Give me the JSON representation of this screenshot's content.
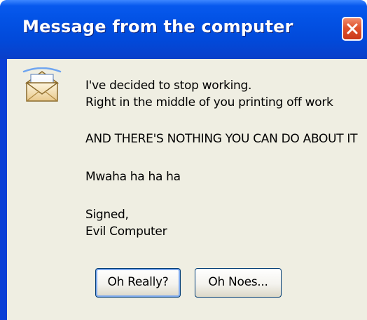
{
  "window": {
    "title": "Message from the computer"
  },
  "icons": {
    "close": "close-x-icon",
    "message": "envelope-message-icon"
  },
  "colors": {
    "titlebar": "#0453e8",
    "close_button": "#e0522c",
    "dialog_body": "#efeee2",
    "default_button_focus": "#7ba7ec"
  },
  "message": {
    "line1": "I've decided to stop working.",
    "line2": "Right in the middle of you printing off work",
    "line3": "AND THERE'S NOTHING YOU CAN DO ABOUT IT",
    "line4": "Mwaha ha ha ha",
    "line5": "Signed,",
    "line6": "Evil Computer"
  },
  "buttons": {
    "really": "Oh Really?",
    "noes": "Oh Noes..."
  }
}
